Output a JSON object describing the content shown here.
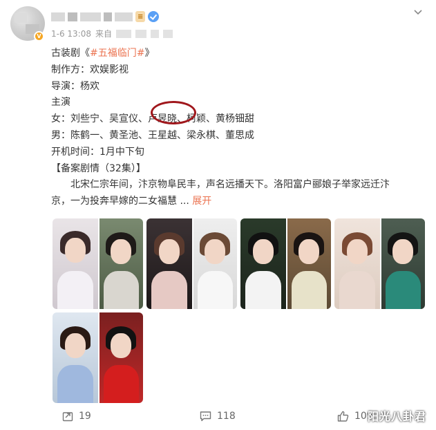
{
  "post": {
    "timestamp": "1-6 13:08",
    "source_prefix": "来自",
    "level_badge": "≡",
    "vip_badge_glyph": "✓"
  },
  "content": {
    "line1_prefix": "古装剧《",
    "line1_topic": "#五福临门#",
    "line1_suffix": "》",
    "producer": "制作方：欢娱影视",
    "director": "导演：杨欢",
    "cast_heading": "主演",
    "female_cast": "女：刘些宁、吴宣仪、卢昱晓、柯颖、黄杨钿甜",
    "male_cast": "男：陈鹤一、黄圣池、王星越、梁永棋、董思成",
    "start_time": "开机时间：1月中下旬",
    "plot_heading": "【备案剧情（32集）】",
    "plot_line1": "北宋仁宗年间，汴京物阜民丰，声名远播天下。洛阳富户郦娘子举家远迁汴",
    "plot_line2_text": "京，一为投奔早嫁的二女福慧 ... ",
    "expand_label": "展开"
  },
  "images": [
    {
      "label": "photo-pair-1"
    },
    {
      "label": "photo-pair-2"
    },
    {
      "label": "photo-pair-3"
    },
    {
      "label": "photo-pair-4"
    },
    {
      "label": "photo-pair-5"
    }
  ],
  "actions": {
    "repost_count": "19",
    "comment_count": "118",
    "like_count": "109"
  },
  "watermark": "阳光八卦君",
  "colors": {
    "accent": "#eb7350",
    "annotation_circle": "#a0171c",
    "text": "#333333",
    "meta": "#999999"
  }
}
